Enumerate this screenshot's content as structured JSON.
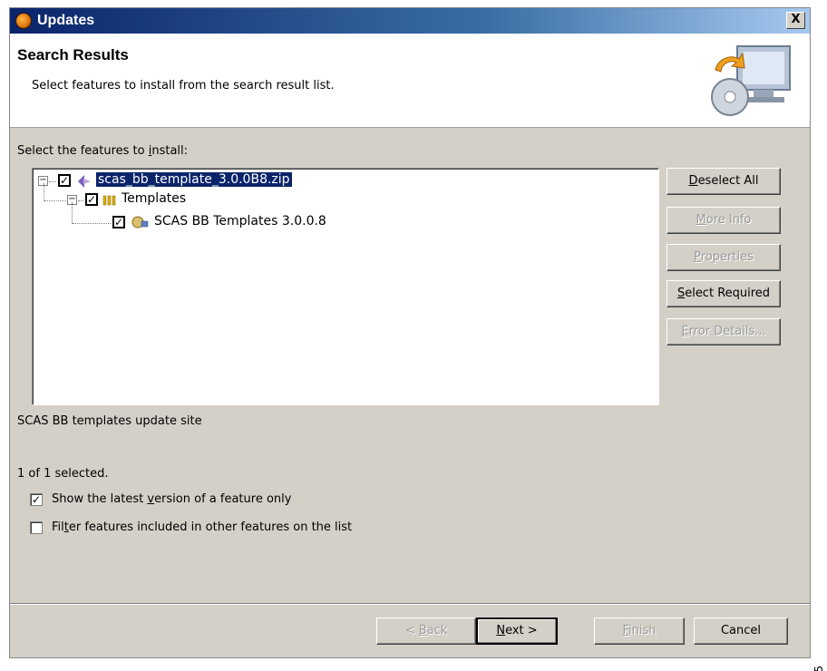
{
  "window": {
    "title": "Updates",
    "close_label": "X"
  },
  "header": {
    "title": "Search Results",
    "description": "Select features to install from the search result list."
  },
  "tree": {
    "label_pre": "Select the features to ",
    "label_mnemonic": "i",
    "label_post": "nstall:",
    "items": [
      {
        "label": "scas_bb_template_3.0.0B8.zip",
        "checked": true,
        "expanded": true,
        "icon": "site-icon"
      },
      {
        "label": "Templates",
        "checked": true,
        "expanded": true,
        "icon": "category-icon"
      },
      {
        "label": "SCAS BB Templates 3.0.0.8",
        "checked": true,
        "icon": "feature-icon"
      }
    ]
  },
  "side_buttons": {
    "deselect_all": {
      "mn": "D",
      "rest": "eselect All",
      "enabled": true
    },
    "more_info": {
      "mn": "M",
      "rest": "ore Info",
      "enabled": false
    },
    "properties": {
      "mn": "P",
      "rest": "roperties",
      "enabled": false
    },
    "select_required": {
      "mn": "S",
      "rest": "elect Required",
      "enabled": true
    },
    "error_details": {
      "mn": "E",
      "rest": "rror Details...",
      "enabled": false
    }
  },
  "site_description": "SCAS BB templates update site",
  "selection_count": "1 of 1 selected.",
  "options": {
    "latest_version": {
      "pre": "Show the latest ",
      "mn": "v",
      "post": "ersion of a feature only",
      "checked": true
    },
    "filter_included": {
      "pre": "Fil",
      "mn": "t",
      "post": "er features included in other features on the list",
      "checked": false
    }
  },
  "footer_buttons": {
    "back": {
      "pre": "< ",
      "mn": "B",
      "post": "ack",
      "enabled": false
    },
    "next": {
      "mn": "N",
      "post": "ext >",
      "enabled": true
    },
    "finish": {
      "mn": "F",
      "post": "inish",
      "enabled": false
    },
    "cancel": {
      "label": "Cancel",
      "enabled": true
    }
  },
  "figure_id": "58965",
  "colors": {
    "selection": "#0a246a",
    "dialog_bg": "#d4d0c8",
    "title_gradient_start": "#0a246a"
  }
}
